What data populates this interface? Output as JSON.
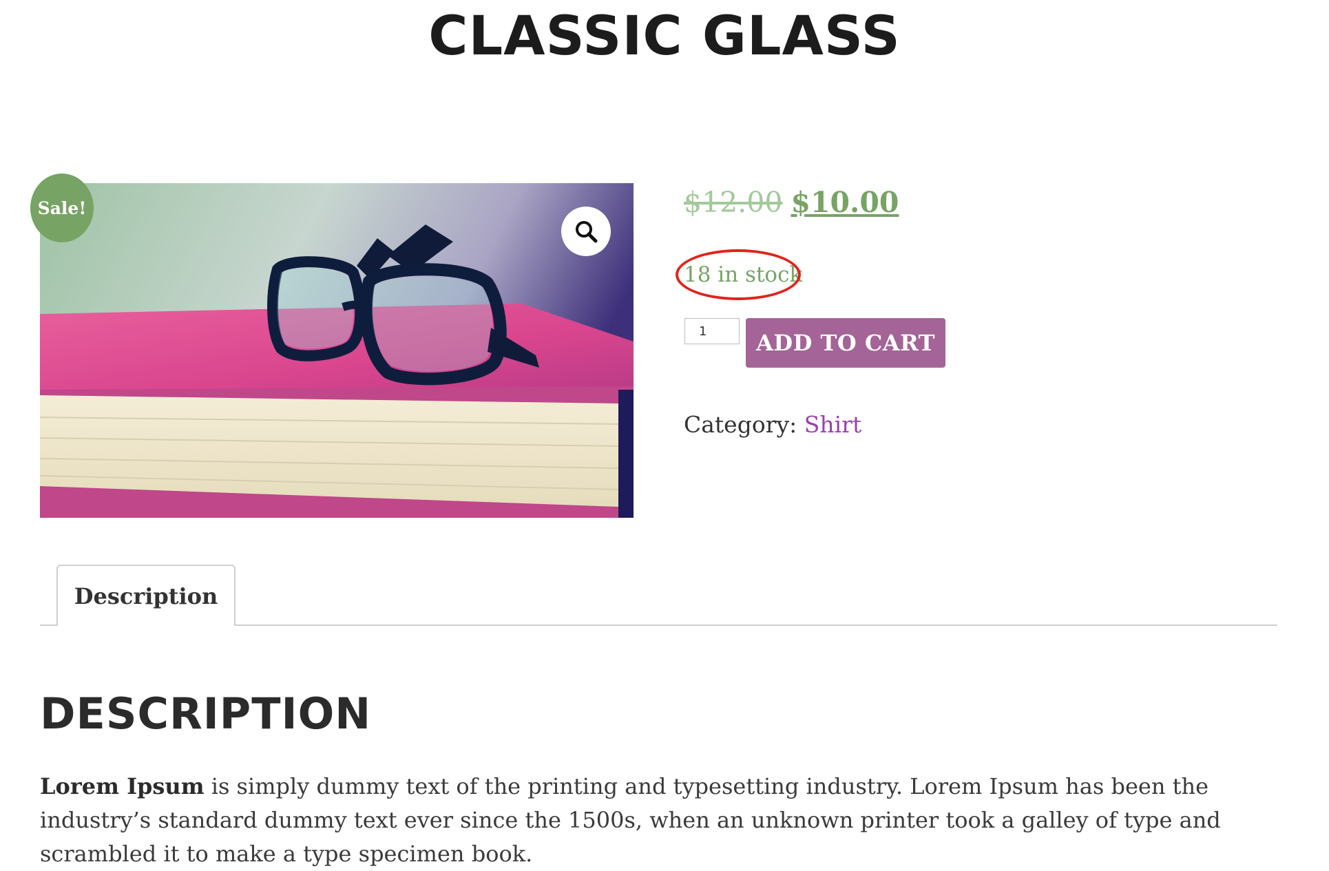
{
  "product": {
    "title": "CLASSIC GLASS",
    "sale_badge": "Sale!",
    "image_icons": {
      "zoom": "magnifier-icon"
    },
    "price_old": "$12.00",
    "price_new": "$10.00",
    "stock": "18 in stock",
    "quantity": "1",
    "add_to_cart_label": "ADD TO CART",
    "category_label": "Category:",
    "category_value": "Shirt"
  },
  "tabs": [
    {
      "label": "Description",
      "active": true
    }
  ],
  "description": {
    "heading": "DESCRIPTION",
    "lead": "Lorem Ipsum",
    "body": " is simply dummy text of the printing and typesetting industry. Lorem Ipsum has been the industry’s standard dummy text ever since the 1500s, when an unknown printer took a galley of type and scrambled it to make a type specimen book."
  },
  "colors": {
    "sale_green": "#77a464",
    "button_purple": "#a46497",
    "link_purple": "#9b3eb1",
    "highlight_red": "#e0231b"
  }
}
